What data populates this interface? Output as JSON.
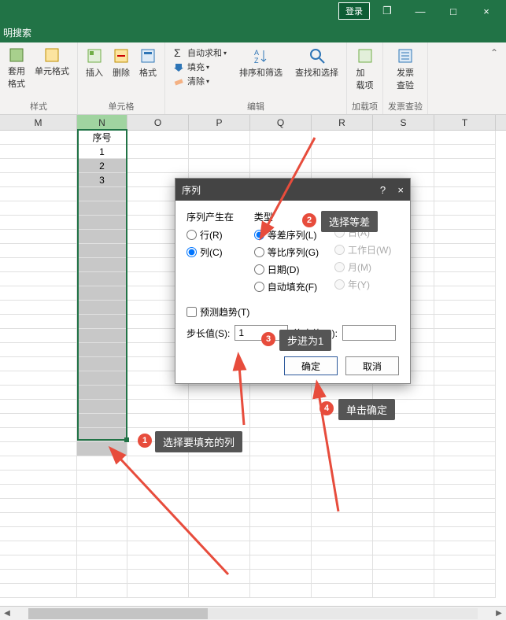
{
  "titlebar": {
    "login": "登录",
    "minimize": "—",
    "restore": "❐",
    "maximize": "□",
    "close": "×"
  },
  "searchbar": {
    "text": "明搜索"
  },
  "ribbon": {
    "styles": {
      "applyFormat": "套用\n格式",
      "cellStyle": "单元格式",
      "groupLabel": "样式"
    },
    "cells": {
      "insert": "插入",
      "delete": "删除",
      "format": "格式",
      "groupLabel": "单元格"
    },
    "editing": {
      "autosum": "自动求和",
      "fill": "填充",
      "clear": "清除",
      "sortFilter": "排序和筛选",
      "findSelect": "查找和选择",
      "groupLabel": "编辑"
    },
    "addins": {
      "addins": "加\n载项",
      "groupLabel": "加载项"
    },
    "invoice": {
      "invoiceCheck": "发票\n查验",
      "groupLabel": "发票查验"
    }
  },
  "columns": [
    "M",
    "N",
    "O",
    "P",
    "Q",
    "R",
    "S",
    "T"
  ],
  "header_cell": "序号",
  "data_cells": [
    "1",
    "2",
    "3"
  ],
  "dialog": {
    "title": "序列",
    "group1": {
      "header": "序列产生在",
      "row": "行(R)",
      "col": "列(C)"
    },
    "group2": {
      "header": "类型",
      "arith": "等差序列(L)",
      "geom": "等比序列(G)",
      "date": "日期(D)",
      "autofill": "自动填充(F)"
    },
    "group3": {
      "day": "日(A)",
      "workday": "工作日(W)",
      "month": "月(M)",
      "year": "年(Y)"
    },
    "trend": "预测趋势(T)",
    "stepLabel": "步长值(S):",
    "stepValue": "1",
    "stopLabel": "终止值(O):",
    "stopValue": "",
    "ok": "确定",
    "cancel": "取消"
  },
  "callouts": {
    "c1": "选择要填充的列",
    "c2": "选择等差",
    "c3": "步进为1",
    "c4": "单击确定",
    "n1": "1",
    "n2": "2",
    "n3": "3",
    "n4": "4"
  }
}
